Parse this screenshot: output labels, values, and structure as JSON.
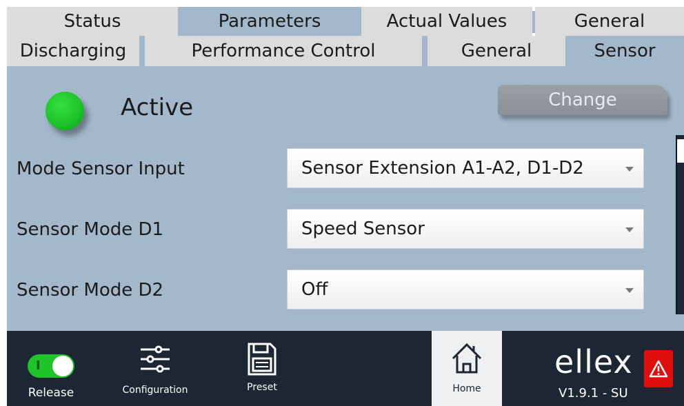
{
  "tabs_top": [
    {
      "label": "Status",
      "active": false
    },
    {
      "label": "Parameters",
      "active": true
    },
    {
      "label": "Actual Values",
      "active": false
    },
    {
      "label": "General",
      "active": false
    }
  ],
  "tabs_sub": [
    {
      "label": "Discharging",
      "active": false
    },
    {
      "label": "Performance Control",
      "active": false
    },
    {
      "label": "General",
      "active": false
    },
    {
      "label": "Sensor",
      "active": true
    }
  ],
  "status": {
    "label": "Active",
    "led_color": "#1ec42a"
  },
  "change_button": "Change",
  "fields": [
    {
      "label": "Mode Sensor Input",
      "value": "Sensor Extension A1-A2, D1-D2"
    },
    {
      "label": "Sensor Mode D1",
      "value": "Speed Sensor"
    },
    {
      "label": "Sensor Mode D2",
      "value": "Off"
    }
  ],
  "bottom_nav": {
    "release": {
      "label": "Release",
      "toggle_state": "on",
      "toggle_mark": "I"
    },
    "configuration": {
      "label": "Configuration",
      "icon": "sliders-icon"
    },
    "preset": {
      "label": "Preset",
      "icon": "save-icon"
    },
    "home": {
      "label": "Home",
      "icon": "home-icon"
    }
  },
  "brand": {
    "logo": "ellex",
    "version": "V1.9.1 - SU"
  },
  "alarm": {
    "icon": "warning-icon",
    "color": "#e10e0e"
  },
  "colors": {
    "panel": "#a4b8cc",
    "tab_inactive": "#dcdcdc",
    "bottom_bar": "#1c2733"
  }
}
